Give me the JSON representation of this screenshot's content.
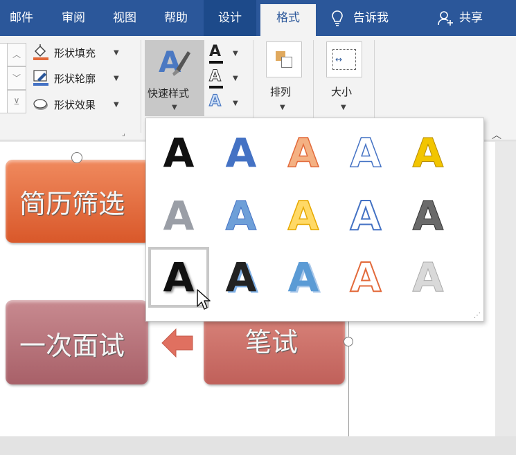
{
  "tabs": [
    "邮件",
    "审阅",
    "视图",
    "帮助",
    "设计",
    "格式"
  ],
  "tell_me": "告诉我",
  "share": "共享",
  "shape_styles": {
    "fill": "形状填充",
    "outline": "形状轮廓",
    "effects": "形状效果"
  },
  "quick_styles": "快速样式",
  "arrange": "排列",
  "size": "大小",
  "gallery_letter": "A",
  "slide": {
    "box1": "简历筛选",
    "box2": "一次面试",
    "box3": "笔试"
  },
  "colors": {
    "tabbar": "#2b579a",
    "orange": "#e2693a",
    "rose": "#b86d74",
    "salmon": "#cd6f66"
  }
}
